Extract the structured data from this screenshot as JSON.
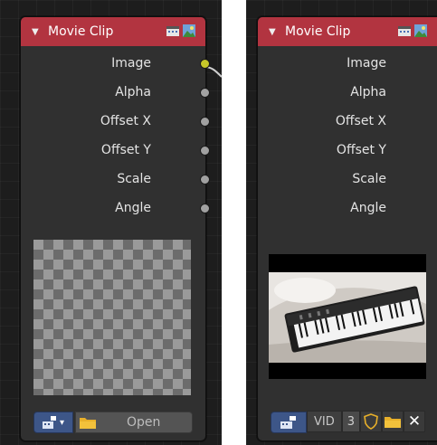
{
  "nodes": [
    {
      "title": "Movie Clip",
      "outputs": [
        "Image",
        "Alpha",
        "Offset X",
        "Offset Y",
        "Scale",
        "Angle"
      ],
      "footer": {
        "open_label": "Open"
      }
    },
    {
      "title": "Movie Clip",
      "outputs": [
        "Image",
        "Alpha",
        "Offset X",
        "Offset Y",
        "Scale",
        "Angle"
      ],
      "footer": {
        "clip_name": "VID",
        "user_count": "3"
      }
    }
  ],
  "icons": {
    "collapse": "disclosure-triangle-icon",
    "header": [
      "movie-clip-icon",
      "image-preview-icon"
    ],
    "footer": [
      "clip-browse-icon",
      "chevron-down-icon",
      "folder-icon",
      "fake-user-shield-icon",
      "close-x-icon"
    ]
  },
  "colors": {
    "canvas_bg": "#1d1d1d",
    "node_body": "#303030",
    "node_header": "#b23440",
    "image_socket": "#c7c729",
    "value_socket": "#a1a1a1",
    "picker_blue": "#3d5688",
    "folder_yellow": "#e8b02a"
  }
}
